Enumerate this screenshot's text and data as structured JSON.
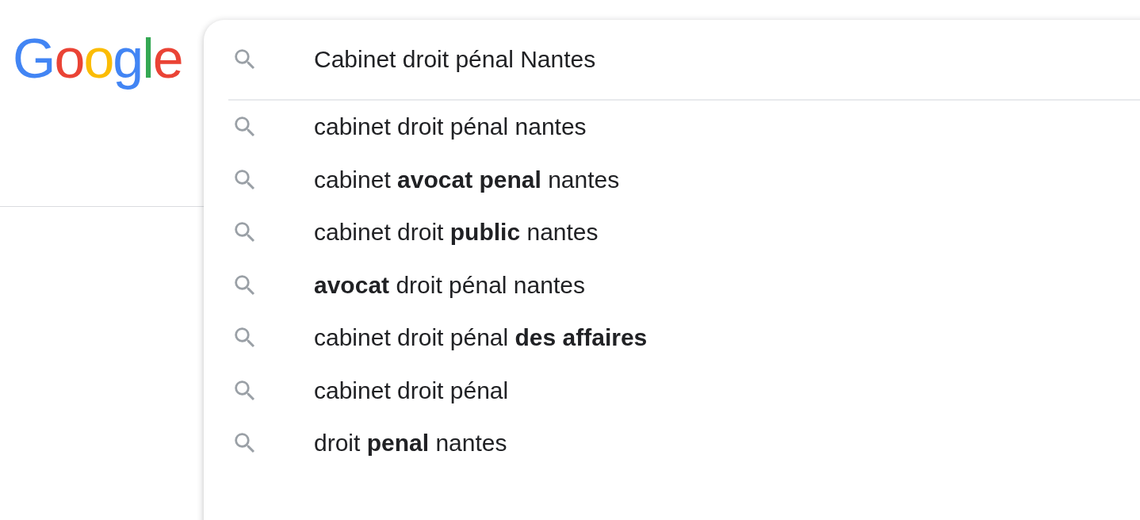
{
  "logo": "Google",
  "search": {
    "value": "Cabinet droit pénal Nantes"
  },
  "suggestions": [
    "cabinet droit pénal nantes",
    "cabinet **avocat penal** nantes",
    "cabinet droit **public** nantes",
    "**avocat** droit pénal nantes",
    "cabinet droit pénal **des affaires**",
    "cabinet droit pénal",
    "droit **penal** nantes"
  ]
}
